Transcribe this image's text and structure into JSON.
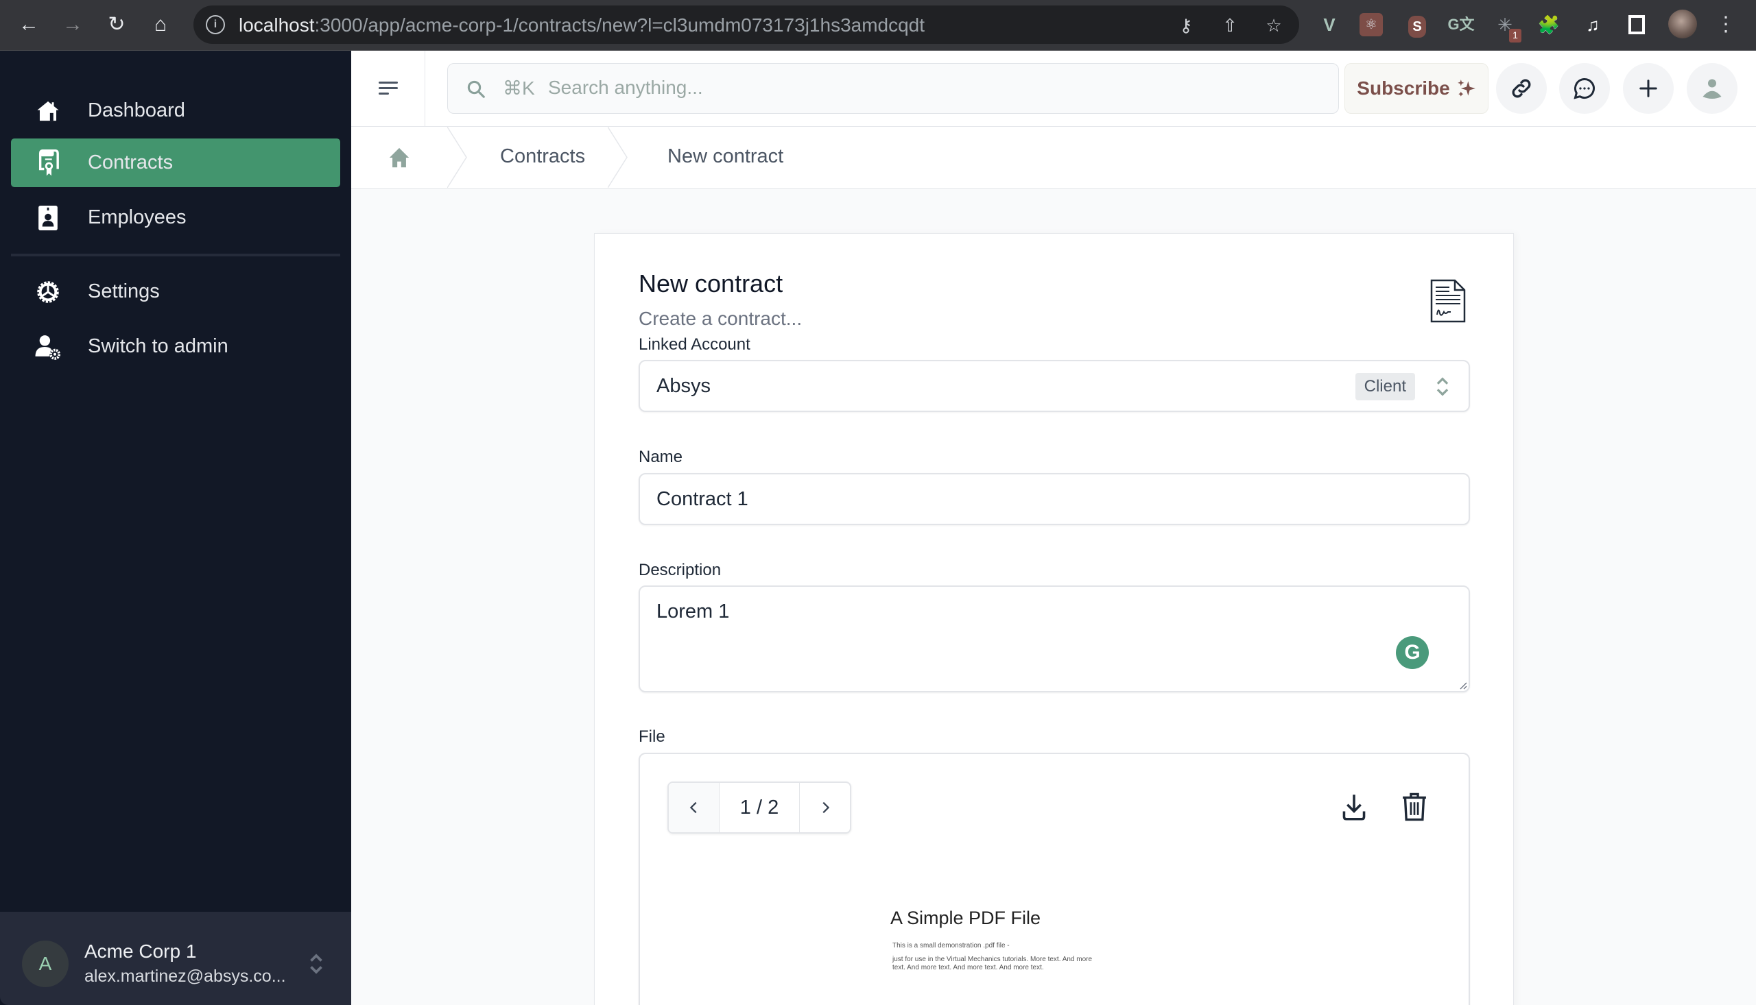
{
  "browser": {
    "url_host": "localhost",
    "url_rest": ":3000/app/acme-corp-1/contracts/new?l=cl3umdm073173j1hs3amdcqdt",
    "extension_badge": "1",
    "icons": [
      "back-icon",
      "forward-icon",
      "reload-icon",
      "home-icon",
      "site-info-icon",
      "key-icon",
      "share-icon",
      "star-icon",
      "vue-devtools-icon",
      "react-devtools-icon",
      "svelte-icon",
      "translate-icon",
      "extension-badge-icon",
      "puzzle-icon",
      "media-icon",
      "side-panel-icon",
      "profile-avatar",
      "more-icon"
    ]
  },
  "sidebar": {
    "items": [
      {
        "label": "Dashboard",
        "icon": "home-icon",
        "active": false
      },
      {
        "label": "Contracts",
        "icon": "contract-icon",
        "active": true
      },
      {
        "label": "Employees",
        "icon": "badge-icon",
        "active": false
      },
      {
        "label": "Settings",
        "icon": "gear-icon",
        "active": false
      },
      {
        "label": "Switch to admin",
        "icon": "user-gear-icon",
        "active": false
      }
    ],
    "account": {
      "avatar_letter": "A",
      "org_name": "Acme Corp 1",
      "email": "alex.martinez@absys.co..."
    }
  },
  "header": {
    "search_shortcut": "⌘K",
    "search_placeholder": "Search anything...",
    "subscribe_label": "Subscribe",
    "actions": [
      "link-icon",
      "chat-icon",
      "plus-icon",
      "user-icon"
    ]
  },
  "breadcrumb": {
    "items": [
      "Contracts",
      "New contract"
    ]
  },
  "form": {
    "title": "New contract",
    "subtitle": "Create a contract...",
    "linked_account": {
      "label": "Linked Account",
      "value": "Absys",
      "badge": "Client"
    },
    "name": {
      "label": "Name",
      "value": "Contract 1"
    },
    "description": {
      "label": "Description",
      "value": "Lorem 1",
      "grammarly_letter": "G"
    },
    "file": {
      "label": "File",
      "page_indicator": "1 / 2",
      "preview": {
        "title": "A Simple PDF File",
        "lines": [
          "This is a small demonstration .pdf file -",
          "just for use in the Virtual Mechanics tutorials. More text. And more",
          "text. And more text. And more text. And more text."
        ]
      }
    }
  },
  "colors": {
    "sidebar_bg": "#121826",
    "active_green": "#43956e",
    "subscribe_text": "#7b4f4a",
    "page_bg": "#f9fafb"
  }
}
